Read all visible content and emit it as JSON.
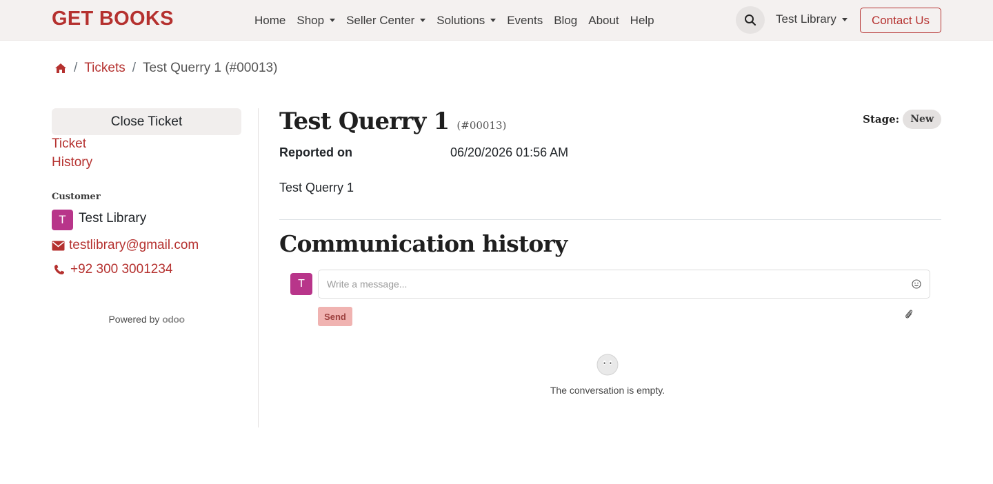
{
  "header": {
    "brand": "GET BOOKS",
    "nav": [
      {
        "label": "Home",
        "dropdown": false
      },
      {
        "label": "Shop",
        "dropdown": true
      },
      {
        "label": "Seller Center",
        "dropdown": true
      },
      {
        "label": "Solutions",
        "dropdown": true
      },
      {
        "label": "Events",
        "dropdown": false
      },
      {
        "label": "Blog",
        "dropdown": false
      },
      {
        "label": "About",
        "dropdown": false
      },
      {
        "label": "Help",
        "dropdown": false
      }
    ],
    "search_icon": "search-icon",
    "user_menu": "Test Library",
    "contact_button": "Contact Us"
  },
  "breadcrumb": {
    "home_icon": "home-icon",
    "link": "Tickets",
    "current": "Test Querry 1 (#00013)"
  },
  "sidebar": {
    "close_button": "Close Ticket",
    "links": [
      "Ticket",
      "History"
    ],
    "customer_heading": "Customer",
    "customer": {
      "avatar_initial": "T",
      "name": "Test Library",
      "email": "testlibrary@gmail.com",
      "phone": "+92 300 3001234"
    },
    "powered_by": "Powered by",
    "powered_brand": "odoo"
  },
  "ticket": {
    "title": "Test Querry 1",
    "ref": "(#00013)",
    "stage_label": "Stage:",
    "stage": "New",
    "reported_label": "Reported on",
    "reported_value": "06/20/2026 01:56 AM",
    "description": "Test Querry 1"
  },
  "communication": {
    "title": "Communication history",
    "avatar_initial": "T",
    "placeholder": "Write a message...",
    "send_label": "Send",
    "empty_text": "The conversation is empty."
  },
  "colors": {
    "accent": "#b5312f",
    "avatar": "#b8358a",
    "header_bg": "#f4f1f0"
  }
}
